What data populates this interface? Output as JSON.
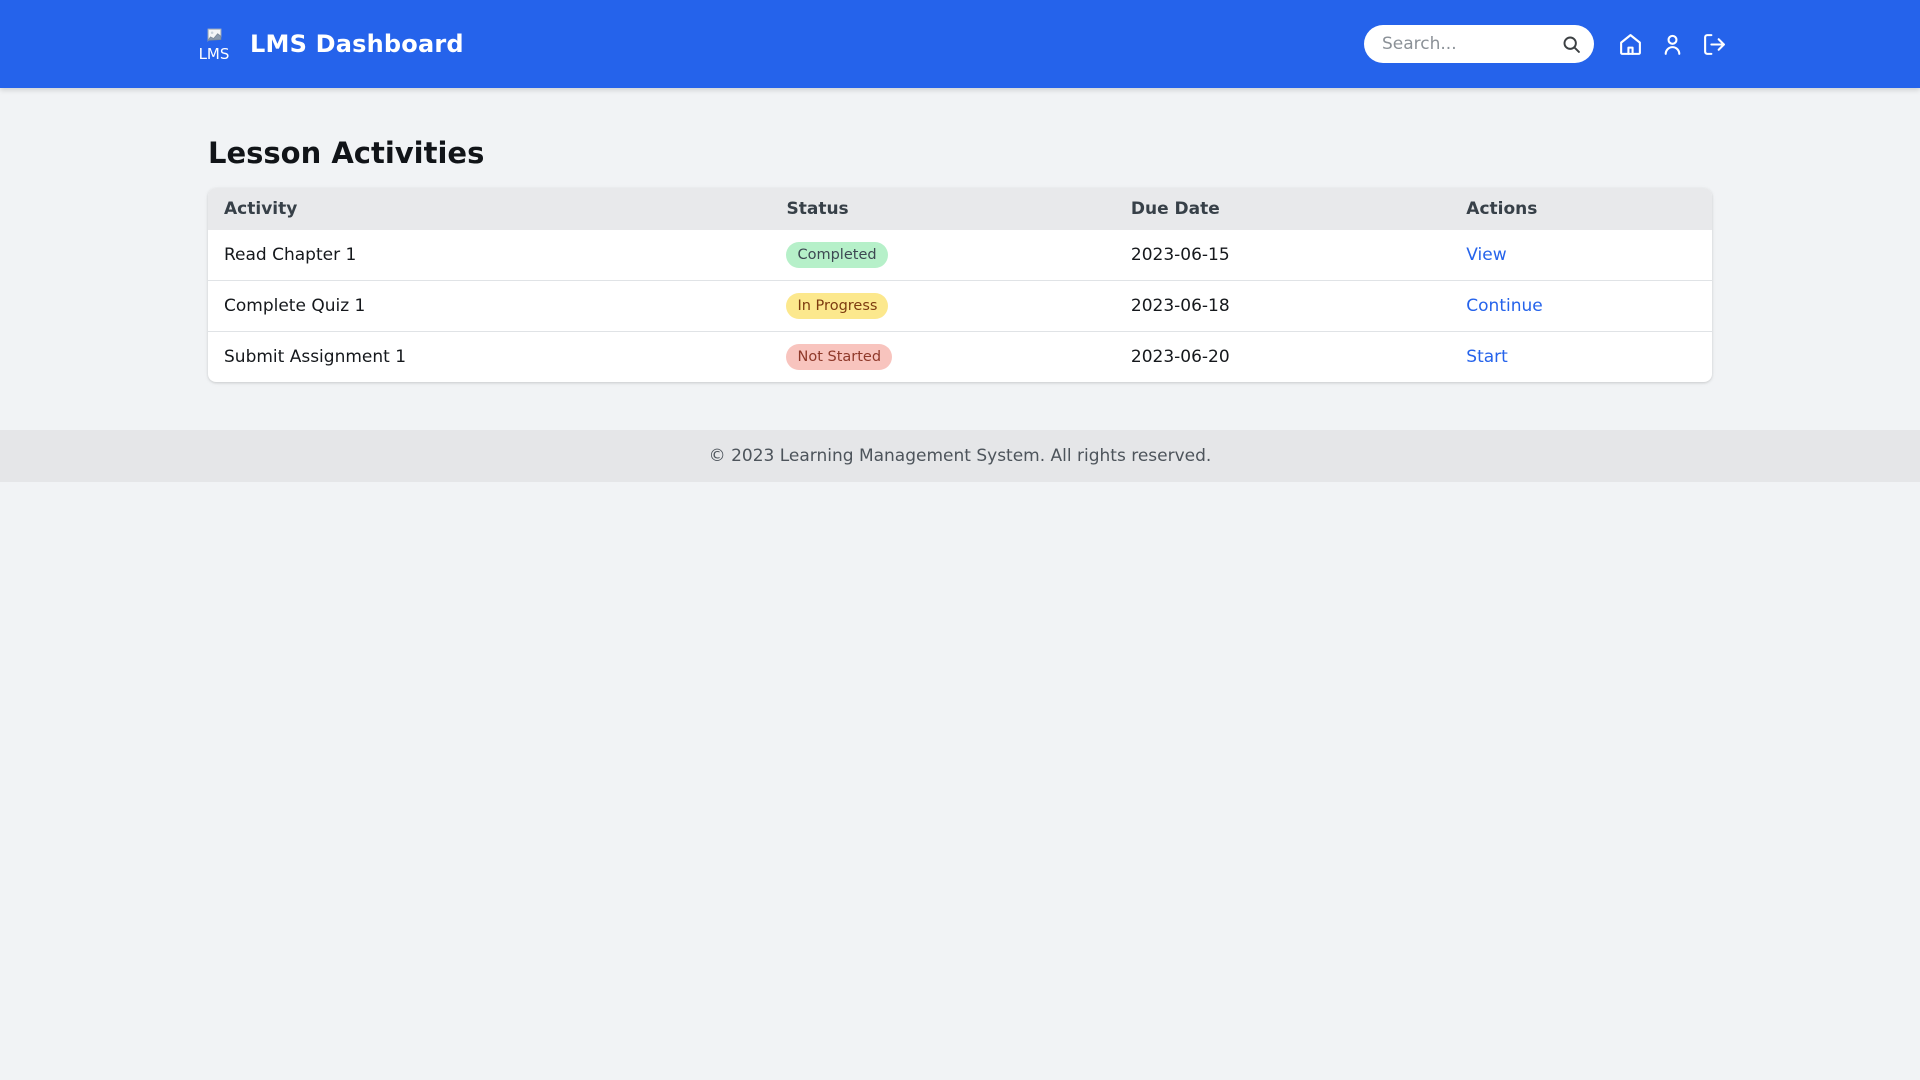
{
  "colors": {
    "header_bg": "#2563eb",
    "page_bg": "#f1f3f5",
    "footer_bg": "#e5e6e8",
    "table_header_bg": "#e8e9eb",
    "row_divider": "#e0e3e6",
    "link": "#2563eb",
    "badge_completed_bg": "#b6f0c9",
    "badge_completed_text": "#3d4852",
    "badge_in_progress_bg": "#fce88d",
    "badge_in_progress_text": "#7d3c10",
    "badge_not_started_bg": "#f8c4be",
    "badge_not_started_text": "#8f392a"
  },
  "header": {
    "logo_alt": "LMS",
    "title": "LMS Dashboard",
    "search_placeholder": "Search..."
  },
  "main": {
    "heading": "Lesson Activities"
  },
  "table": {
    "columns": [
      "Activity",
      "Status",
      "Due Date",
      "Actions"
    ],
    "rows": [
      {
        "activity": "Read Chapter 1",
        "status": "Completed",
        "status_type": "completed",
        "due_date": "2023-06-15",
        "action": "View"
      },
      {
        "activity": "Complete Quiz 1",
        "status": "In Progress",
        "status_type": "in-progress",
        "due_date": "2023-06-18",
        "action": "Continue"
      },
      {
        "activity": "Submit Assignment 1",
        "status": "Not Started",
        "status_type": "not-started",
        "due_date": "2023-06-20",
        "action": "Start"
      }
    ]
  },
  "footer": {
    "text": "© 2023 Learning Management System. All rights reserved."
  }
}
